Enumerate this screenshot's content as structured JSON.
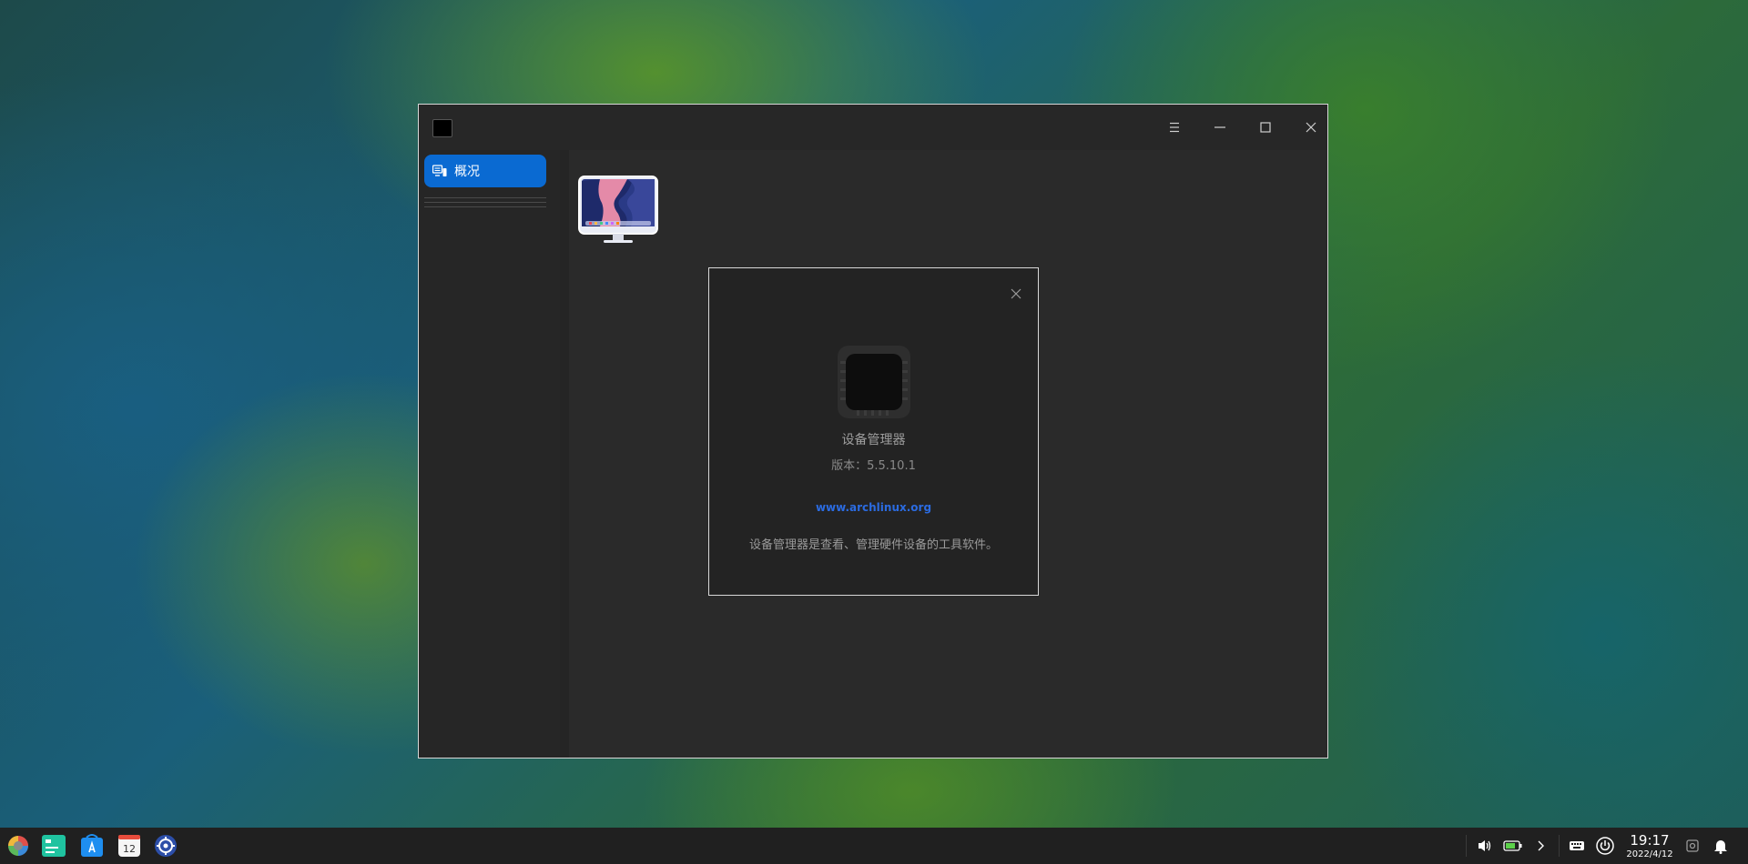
{
  "window": {
    "sidebar": {
      "items": [
        {
          "label": "概况",
          "icon": "overview-icon",
          "selected": true
        }
      ]
    }
  },
  "about": {
    "app_name": "设备管理器",
    "version": "版本：5.5.10.1",
    "website": "www.archlinux.org",
    "description": "设备管理器是查看、管理硬件设备的工具软件。"
  },
  "taskbar": {
    "apps": [
      "launcher-icon",
      "deepin-terminal-icon",
      "app-store-icon",
      "calendar-icon",
      "settings-icon"
    ],
    "calendar_day": "12",
    "clock": {
      "time": "19:17",
      "date": "2022/4/12"
    }
  },
  "colors": {
    "accent": "#0a6ad2",
    "link": "#2b6be0",
    "window_bg": "#282828",
    "taskbar_bg": "#202020"
  }
}
